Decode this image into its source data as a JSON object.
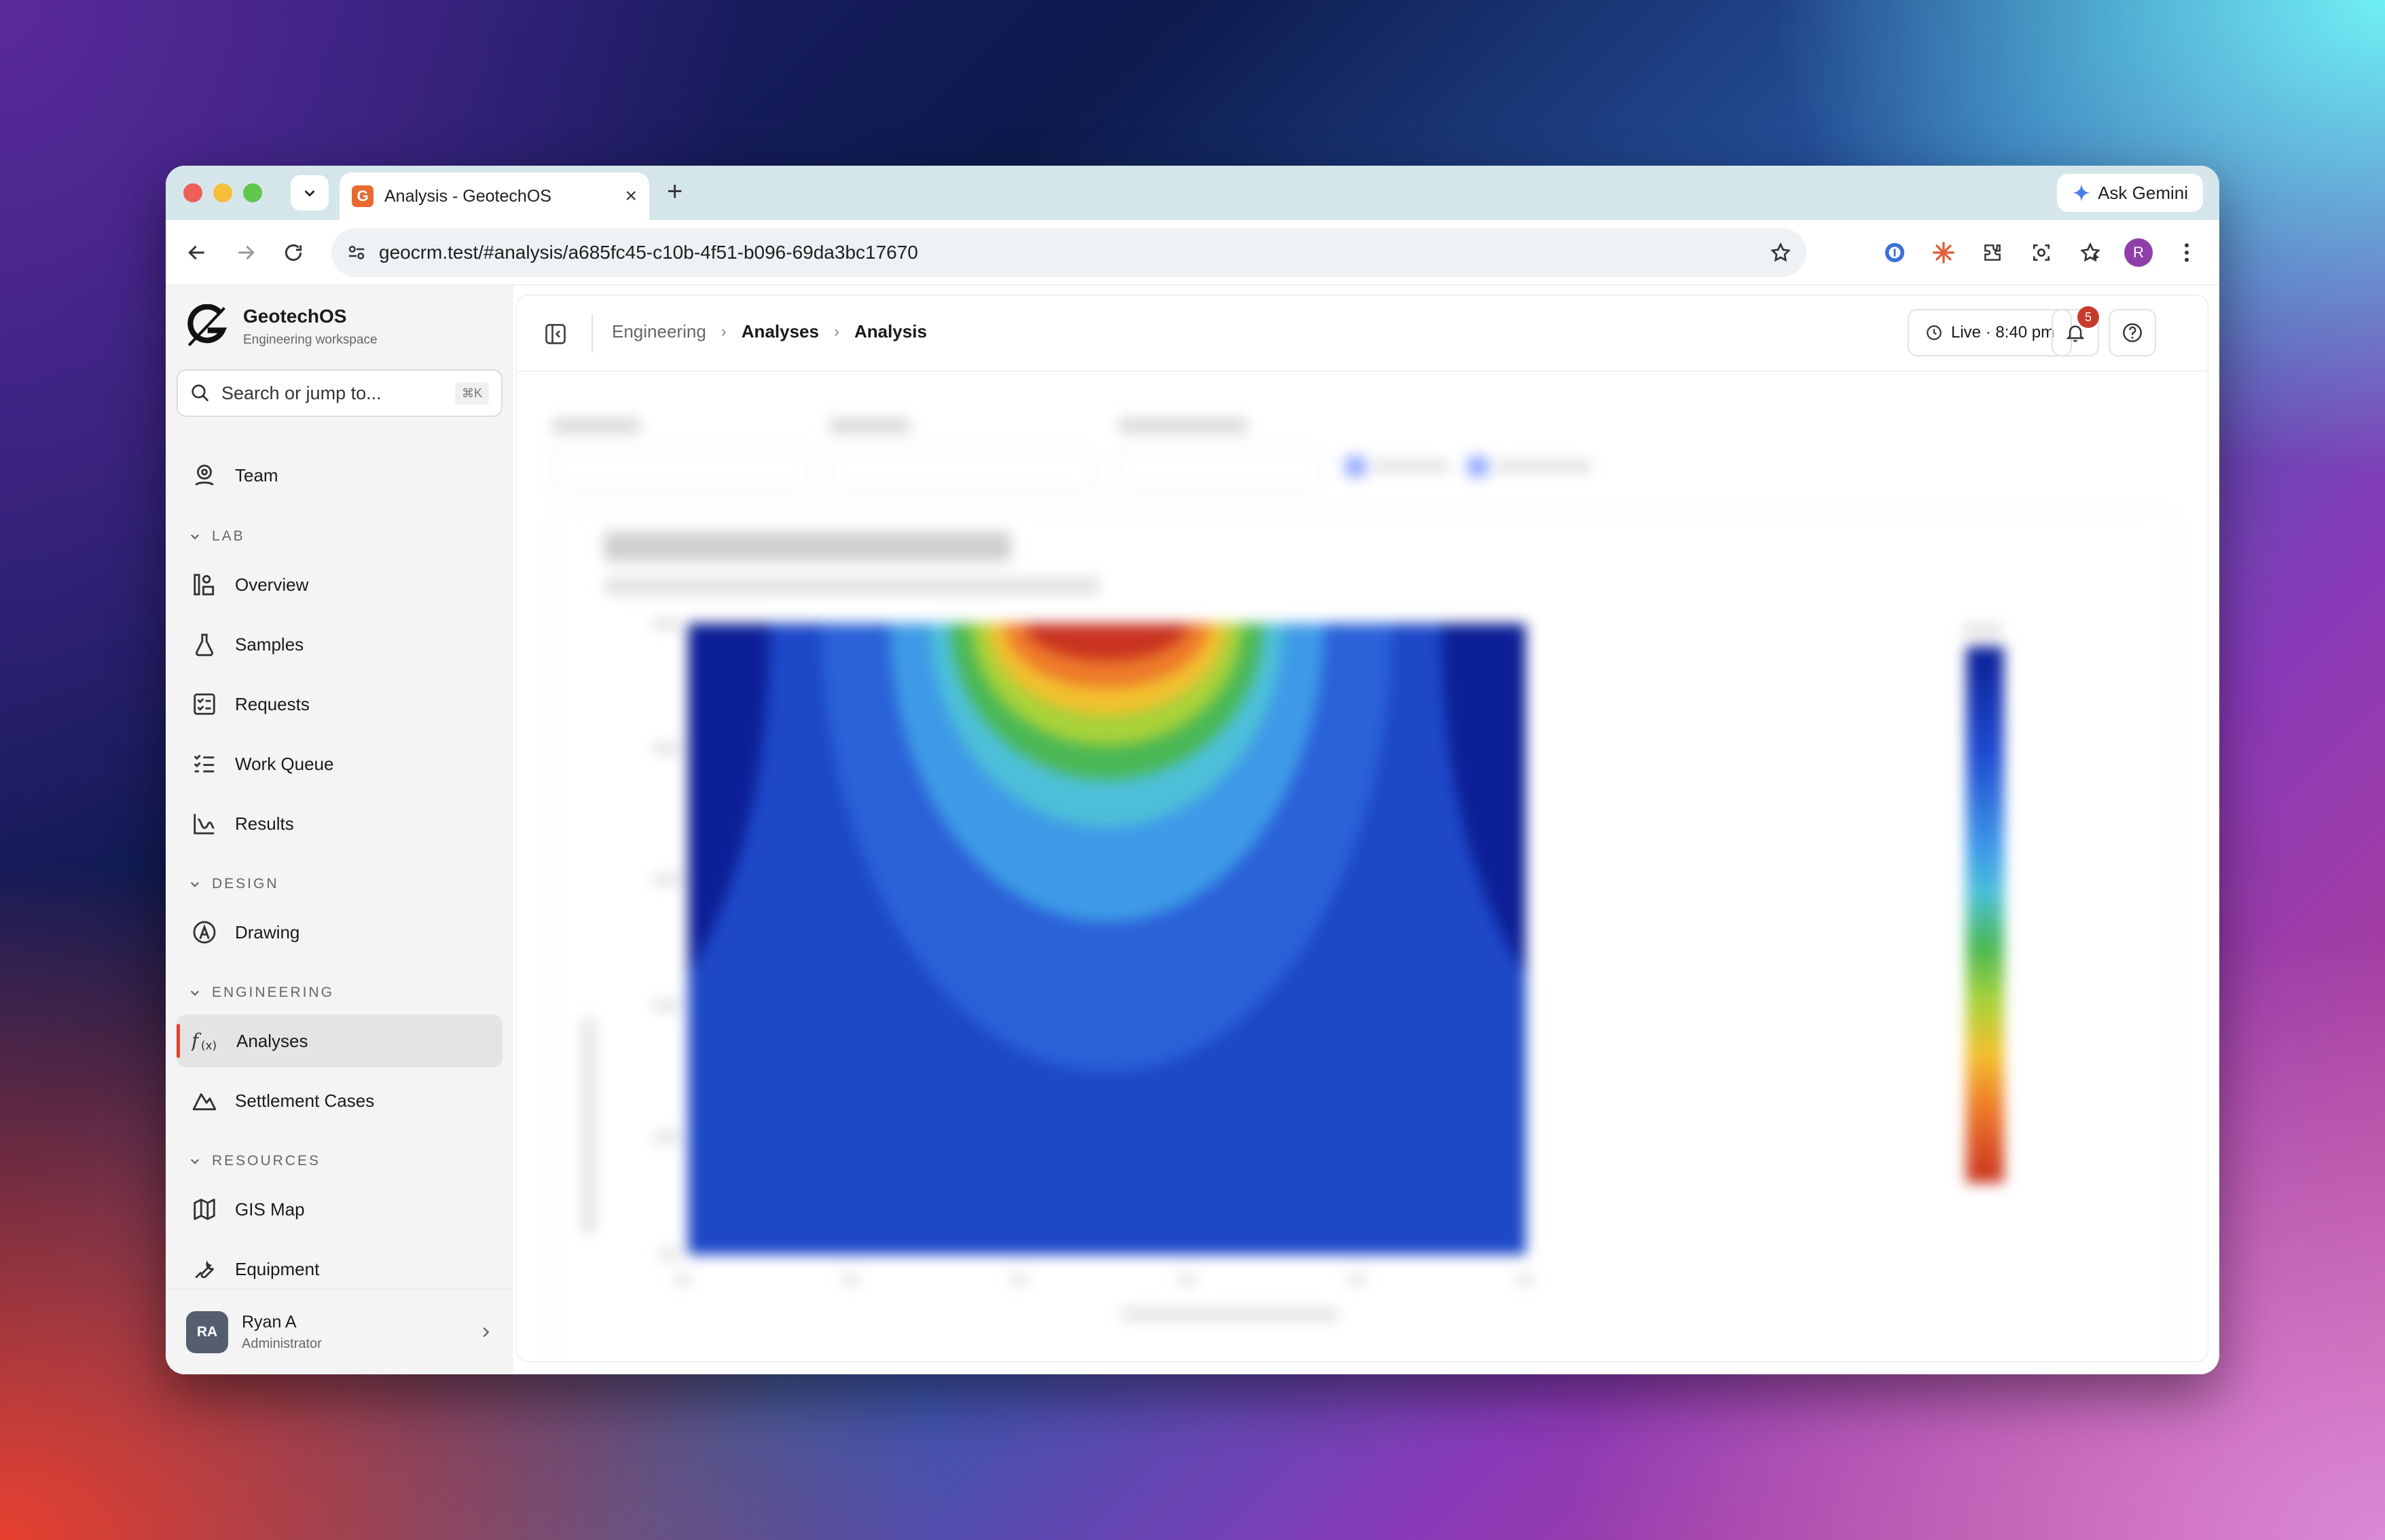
{
  "browser": {
    "tab_title": "Analysis - GeotechOS",
    "favicon_letter": "G",
    "ask_gemini": "Ask Gemini",
    "url": "geocrm.test/#analysis/a685fc45-c10b-4f51-b096-69da3bc17670",
    "profile_initial": "R"
  },
  "sidebar": {
    "brand_name": "GeotechOS",
    "brand_sub": "Engineering workspace",
    "search_placeholder": "Search or jump to...",
    "search_shortcut": "⌘K",
    "team": "Team",
    "sections": {
      "lab": "LAB",
      "design": "DESIGN",
      "engineering": "ENGINEERING",
      "resources": "RESOURCES"
    },
    "items": {
      "overview": "Overview",
      "samples": "Samples",
      "requests": "Requests",
      "work_queue": "Work Queue",
      "results": "Results",
      "drawing": "Drawing",
      "analyses": "Analyses",
      "settlement_cases": "Settlement Cases",
      "gis_map": "GIS Map",
      "equipment": "Equipment"
    },
    "active_item": "Analyses",
    "user": {
      "initials": "RA",
      "name": "Ryan A",
      "role": "Administrator"
    }
  },
  "header": {
    "breadcrumb": [
      "Engineering",
      "Analyses",
      "Analysis"
    ],
    "live_status": "Live · 8:40 pm",
    "notification_count": "5"
  },
  "colors": {
    "accent": "#e0442d",
    "badge": "#c83a2c",
    "favicon": "#e96a2e",
    "profile": "#8e3fa8"
  }
}
